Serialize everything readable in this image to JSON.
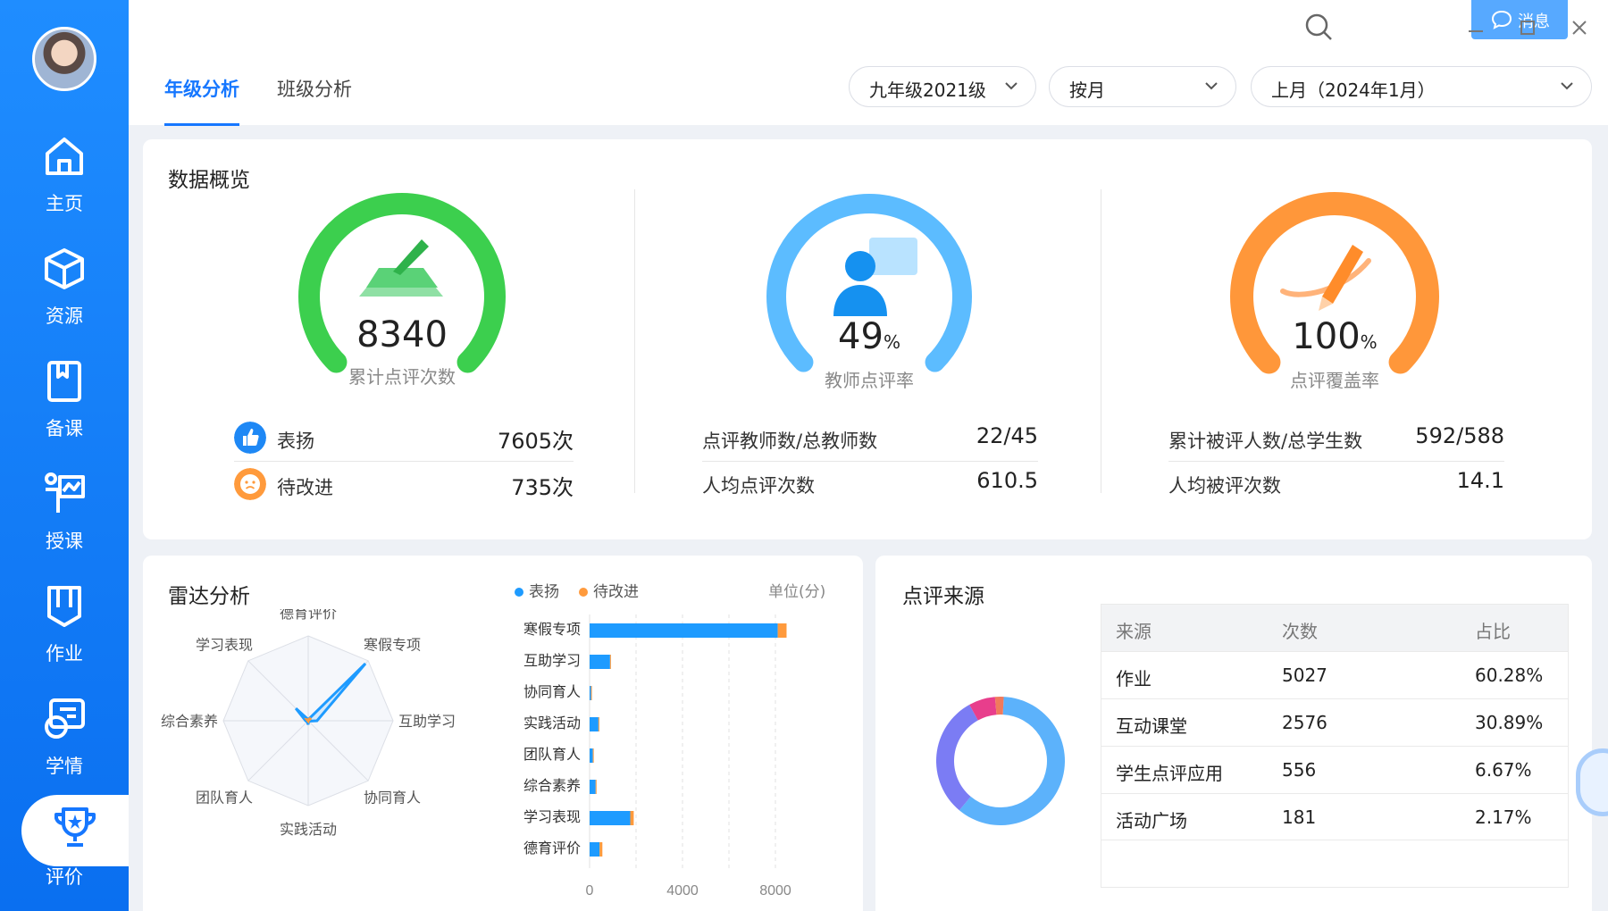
{
  "sidebar": {
    "items": [
      {
        "label": "主页",
        "icon": "home-icon"
      },
      {
        "label": "资源",
        "icon": "cube-icon"
      },
      {
        "label": "备课",
        "icon": "book-icon"
      },
      {
        "label": "授课",
        "icon": "teach-icon"
      },
      {
        "label": "作业",
        "icon": "homework-icon"
      },
      {
        "label": "学情",
        "icon": "analysis-icon"
      },
      {
        "label": "评价",
        "icon": "trophy-icon",
        "active": true
      }
    ]
  },
  "header": {
    "tabs": [
      {
        "label": "年级分析",
        "active": true
      },
      {
        "label": "班级分析",
        "active": false
      }
    ],
    "filters": {
      "grade": "九年级2021级",
      "period_type": "按月",
      "period": "上月（2024年1月）"
    },
    "message_button": "消息"
  },
  "overview": {
    "title": "数据概览",
    "gauges": [
      {
        "value": "8340",
        "unit": "",
        "label": "累计点评次数",
        "color": "#3ccf4e",
        "fraction": 1.0
      },
      {
        "value": "49",
        "unit": "%",
        "label": "教师点评率",
        "color": "#5cbcff",
        "fraction": 1.0
      },
      {
        "value": "100",
        "unit": "%",
        "label": "点评覆盖率",
        "color": "#ff973a",
        "fraction": 1.0
      }
    ],
    "stats_1": [
      {
        "key": "表扬",
        "value": "7605次"
      },
      {
        "key": "待改进",
        "value": "735次"
      }
    ],
    "stats_2": [
      {
        "key": "点评教师数/总教师数",
        "value": "22/45"
      },
      {
        "key": "人均点评次数",
        "value": "610.5"
      }
    ],
    "stats_3": [
      {
        "key": "累计被评人数/总学生数",
        "value": "592/588"
      },
      {
        "key": "人均被评次数",
        "value": "14.1"
      }
    ]
  },
  "radar": {
    "title": "雷达分析",
    "legend_praise": "表扬",
    "legend_improve": "待改进",
    "unit_label": "单位(分)",
    "colors": {
      "praise": "#1e9bff",
      "improve": "#ff9a3c"
    }
  },
  "source": {
    "title": "点评来源",
    "columns": [
      "来源",
      "次数",
      "占比"
    ],
    "rows": [
      {
        "name": "作业",
        "count": "5027",
        "pct": "60.28%",
        "color": "#5cb2fb"
      },
      {
        "name": "互动课堂",
        "count": "2576",
        "pct": "30.89%",
        "color": "#7b7cf4"
      },
      {
        "name": "学生点评应用",
        "count": "556",
        "pct": "6.67%",
        "color": "#e83e8c"
      },
      {
        "name": "活动广场",
        "count": "181",
        "pct": "2.17%",
        "color": "#f07a5c"
      }
    ]
  },
  "chart_data": [
    {
      "type": "radar",
      "axes": [
        "德育评价",
        "寒假专项",
        "互助学习",
        "协同育人",
        "实践活动",
        "团队育人",
        "综合素养",
        "学习表现"
      ],
      "series": [
        {
          "name": "表扬",
          "values": [
            120,
            8100,
            880,
            60,
            380,
            140,
            260,
            1750
          ]
        },
        {
          "name": "待改进",
          "values": [
            90,
            380,
            20,
            10,
            30,
            20,
            20,
            150
          ]
        }
      ],
      "max": 8500
    },
    {
      "type": "bar",
      "orientation": "horizontal",
      "stacked": true,
      "categories": [
        "寒假专项",
        "互助学习",
        "协同育人",
        "实践活动",
        "团队育人",
        "综合素养",
        "学习表现",
        "德育评价"
      ],
      "series": [
        {
          "name": "表扬",
          "values": [
            8100,
            880,
            60,
            380,
            140,
            260,
            1750,
            430
          ]
        },
        {
          "name": "待改进",
          "values": [
            380,
            20,
            10,
            30,
            20,
            20,
            150,
            120
          ]
        }
      ],
      "xticks": [
        "0",
        "4000",
        "8000"
      ],
      "xlim": [
        0,
        10000
      ],
      "unit": "单位(分)"
    },
    {
      "type": "pie",
      "donut": true,
      "labels": [
        "作业",
        "互动课堂",
        "学生点评应用",
        "活动广场"
      ],
      "values": [
        60.28,
        30.89,
        6.67,
        2.17
      ]
    }
  ]
}
